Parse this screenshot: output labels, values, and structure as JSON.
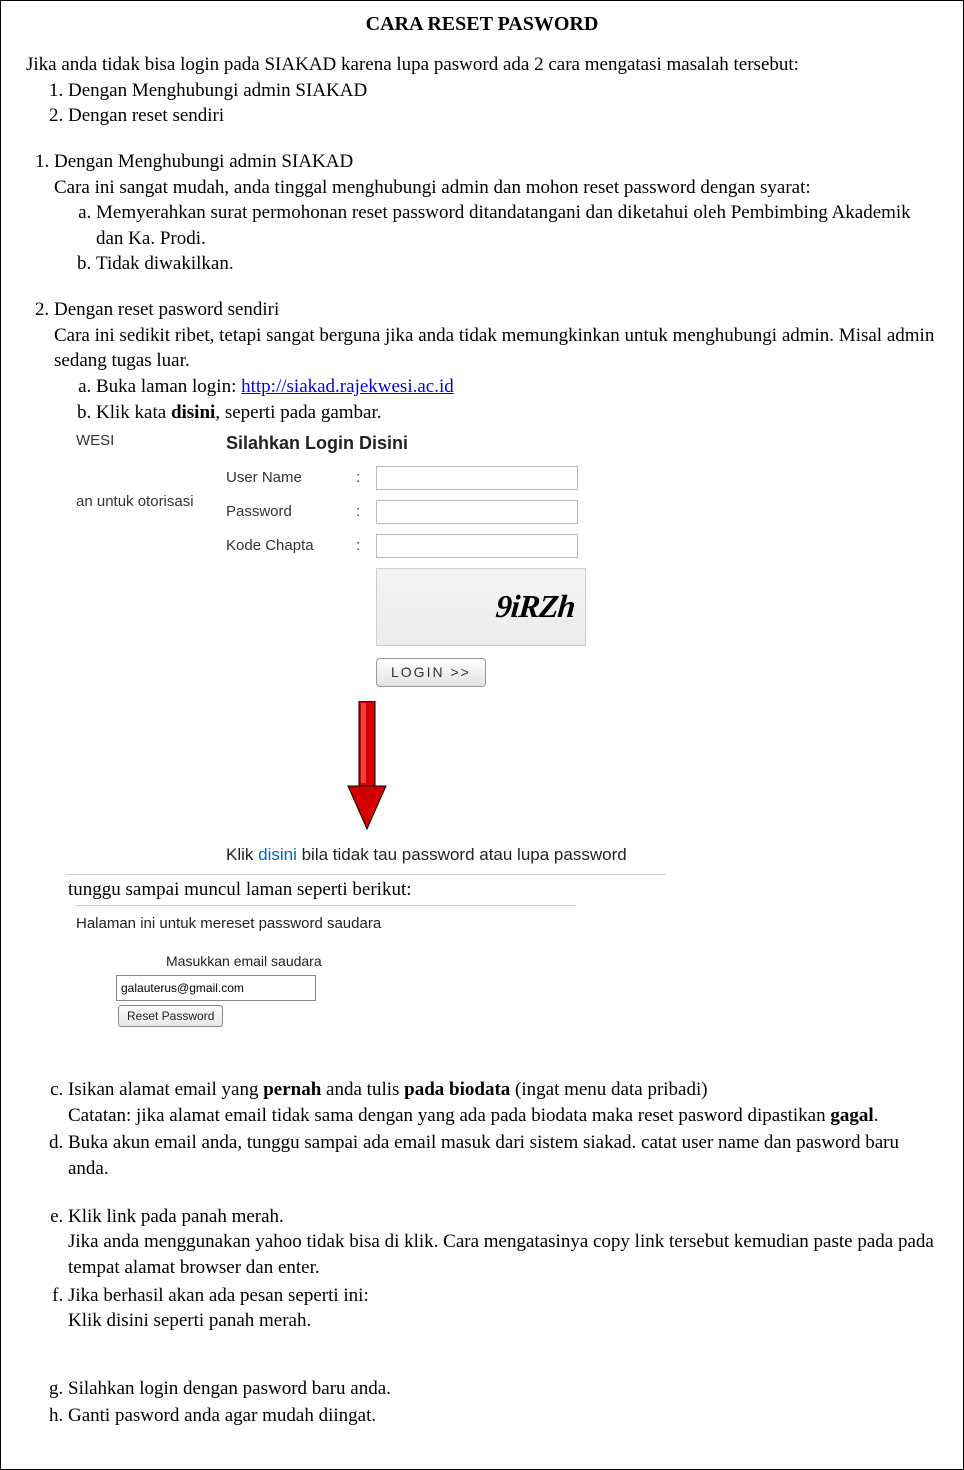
{
  "title": "CARA RESET PASWORD",
  "intro": "Jika anda tidak bisa login pada SIAKAD karena lupa pasword ada 2 cara mengatasi masalah tersebut:",
  "intro_items": [
    "Dengan Menghubungi admin SIAKAD",
    "Dengan reset sendiri"
  ],
  "section1": {
    "heading": "Dengan Menghubungi admin SIAKAD",
    "body": "Cara ini sangat mudah, anda tinggal menghubungi admin dan mohon reset password dengan syarat:",
    "items": [
      "Memyerahkan surat permohonan reset password ditandatangani dan diketahui oleh Pembimbing Akademik dan Ka. Prodi.",
      "Tidak diwakilkan."
    ]
  },
  "section2": {
    "heading": "Dengan reset pasword sendiri",
    "body": "Cara ini sedikit ribet, tetapi sangat berguna jika anda tidak memungkinkan untuk menghubungi admin. Misal admin sedang tugas luar.",
    "item_a_pre": "Buka laman login: ",
    "item_a_link": "http://siakad.rajekwesi.ac.id",
    "item_b_pre": "Klik kata ",
    "item_b_bold": "disini",
    "item_b_post": ", seperti pada gambar."
  },
  "login_form": {
    "left_header": "WESI",
    "left_sub": "an untuk otorisasi",
    "title": "Silahkan Login Disini",
    "user_label": "User Name",
    "pass_label": "Password",
    "captcha_label": "Kode Chapta",
    "captcha_text": "9iRZh",
    "login_button": "LOGIN >>",
    "forgot_klik": "Klik ",
    "forgot_disini": "disini",
    "forgot_rest": " bila tidak tau password atau lupa password"
  },
  "wait_text": "tunggu sampai muncul laman seperti berikut:",
  "reset_form": {
    "heading": "Halaman ini untuk mereset password saudara",
    "input_label": "Masukkan email saudara",
    "input_value": "galauterus@gmail.com",
    "button": "Reset Password"
  },
  "steps": {
    "c_1": "Isikan alamat email yang ",
    "c_b1": "pernah",
    "c_2": " anda tulis ",
    "c_b2": "pada biodata",
    "c_3": " (ingat menu data pribadi)",
    "c_note_1": "Catatan: jika alamat email tidak sama dengan yang ada pada biodata maka reset pasword dipastikan ",
    "c_note_b": "gagal",
    "c_note_2": ".",
    "d": "Buka akun email anda, tunggu sampai ada email masuk dari sistem siakad. catat user name dan pasword baru anda.",
    "e_1": "Klik link pada panah merah.",
    "e_2": "Jika anda menggunakan yahoo tidak bisa di klik. Cara mengatasinya copy link tersebut kemudian paste pada pada tempat alamat browser dan enter.",
    "f_1": "Jika berhasil akan ada pesan seperti ini:",
    "f_2": "Klik disini seperti panah merah.",
    "g": "Silahkan login dengan pasword baru anda.",
    "h": "Ganti pasword anda agar mudah diingat."
  }
}
